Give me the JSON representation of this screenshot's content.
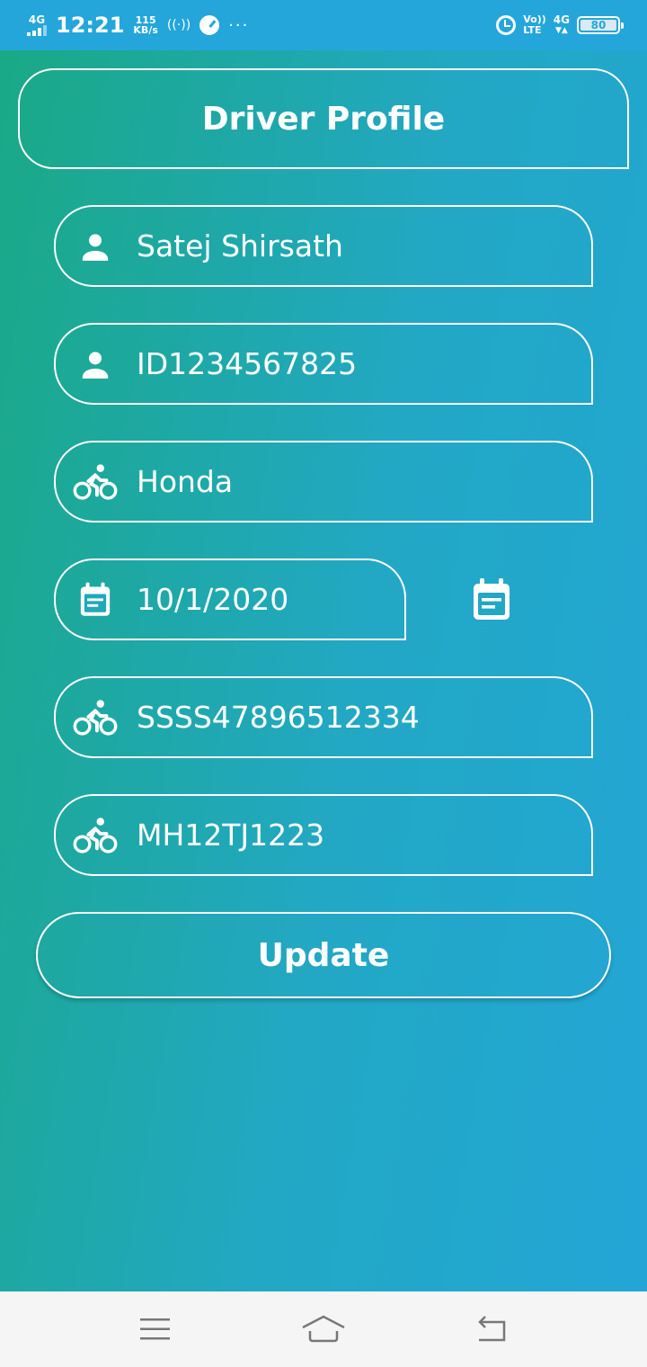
{
  "status_bar": {
    "network": "4G",
    "time": "12:21",
    "speed_value": "115",
    "speed_unit": "KB/s",
    "volte": "Vo))",
    "lte": "LTE",
    "network_right": "4G",
    "battery": "80"
  },
  "header": {
    "title": "Driver Profile"
  },
  "fields": {
    "name": "Satej Shirsath",
    "driver_id": "ID1234567825",
    "vehicle_make": "Honda",
    "date": "10/1/2020",
    "license_number": "SSSS47896512334",
    "vehicle_number": "MH12TJ1223"
  },
  "icons": {
    "person": "person-icon",
    "bike": "bike-icon",
    "calendar": "calendar-icon"
  },
  "actions": {
    "update_label": "Update"
  },
  "colors": {
    "gradient_start": "#1aa985",
    "gradient_end": "#23a6d6",
    "status_bar": "#24a6db",
    "nav_bar": "#f5f5f5"
  }
}
